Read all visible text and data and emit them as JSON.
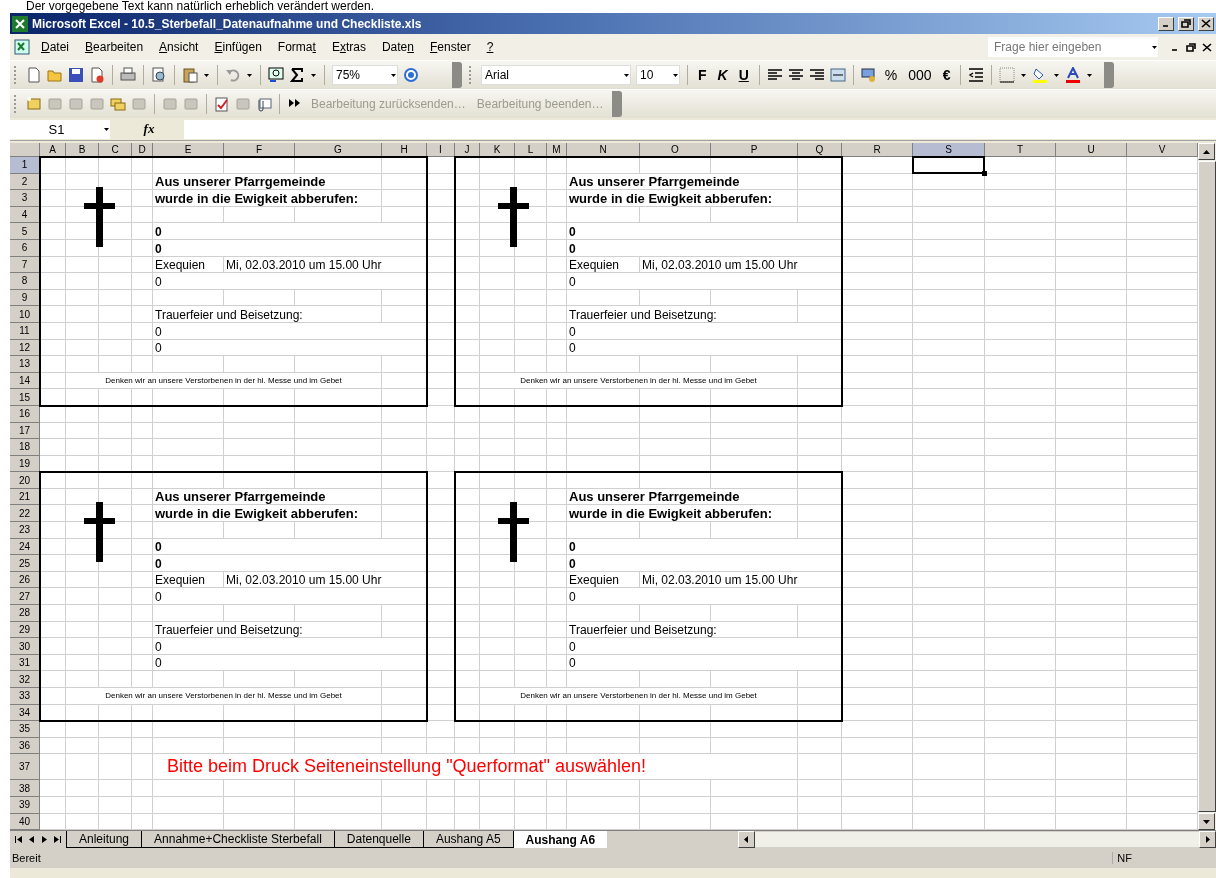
{
  "caption": "Der vorgegebene Text kann natürlich erheblich verändert werden.",
  "window": {
    "title": "Microsoft Excel - 10.5_Sterbefall_Datenaufnahme und Checkliste.xls"
  },
  "menu": [
    {
      "label": "Datei"
    },
    {
      "label": "Bearbeiten"
    },
    {
      "label": "Ansicht"
    },
    {
      "label": "Einfügen"
    },
    {
      "label": "Format"
    },
    {
      "label": "Extras"
    },
    {
      "label": "Daten"
    },
    {
      "label": "Fenster"
    },
    {
      "label": "?"
    }
  ],
  "help_search": {
    "placeholder": "Frage hier eingeben"
  },
  "standard_toolbar": {
    "zoom": "75%"
  },
  "formatting_toolbar": {
    "font": "Arial",
    "size": "10",
    "bold": "F",
    "italic": "K",
    "underline": "U",
    "percent": "%",
    "thousands": "000",
    "euro": "€"
  },
  "review_toolbar": [
    {
      "label": "Bearbeitung zurücksenden…",
      "disabled": true
    },
    {
      "label": "Bearbeitung beenden…",
      "disabled": true
    }
  ],
  "name_box": "S1",
  "formula_label": "fx",
  "columns": [
    {
      "label": "A",
      "selected": false
    },
    {
      "label": "B",
      "selected": false
    },
    {
      "label": "C",
      "selected": false
    },
    {
      "label": "D",
      "selected": false
    },
    {
      "label": "E",
      "selected": false
    },
    {
      "label": "F",
      "selected": false
    },
    {
      "label": "G",
      "selected": false
    },
    {
      "label": "H",
      "selected": false
    },
    {
      "label": "I",
      "selected": false
    },
    {
      "label": "J",
      "selected": false
    },
    {
      "label": "K",
      "selected": false
    },
    {
      "label": "L",
      "selected": false
    },
    {
      "label": "M",
      "selected": false
    },
    {
      "label": "N",
      "selected": false
    },
    {
      "label": "O",
      "selected": false
    },
    {
      "label": "P",
      "selected": false
    },
    {
      "label": "Q",
      "selected": false
    },
    {
      "label": "R",
      "selected": false
    },
    {
      "label": "S",
      "selected": true
    },
    {
      "label": "T",
      "selected": false
    },
    {
      "label": "U",
      "selected": false
    },
    {
      "label": "V",
      "selected": false
    }
  ],
  "rows": [
    {
      "label": "1",
      "selected": true
    },
    {
      "label": "2",
      "selected": false
    },
    {
      "label": "3",
      "selected": false
    },
    {
      "label": "4",
      "selected": false
    },
    {
      "label": "5",
      "selected": false
    },
    {
      "label": "6",
      "selected": false
    },
    {
      "label": "7",
      "selected": false
    },
    {
      "label": "8",
      "selected": false
    },
    {
      "label": "9",
      "selected": false
    },
    {
      "label": "10",
      "selected": false
    },
    {
      "label": "11",
      "selected": false
    },
    {
      "label": "12",
      "selected": false
    },
    {
      "label": "13",
      "selected": false
    },
    {
      "label": "14",
      "selected": false
    },
    {
      "label": "15",
      "selected": false
    },
    {
      "label": "16",
      "selected": false
    },
    {
      "label": "17",
      "selected": false
    },
    {
      "label": "18",
      "selected": false
    },
    {
      "label": "19",
      "selected": false
    },
    {
      "label": "20",
      "selected": false
    },
    {
      "label": "21",
      "selected": false
    },
    {
      "label": "22",
      "selected": false
    },
    {
      "label": "23",
      "selected": false
    },
    {
      "label": "24",
      "selected": false
    },
    {
      "label": "25",
      "selected": false
    },
    {
      "label": "26",
      "selected": false
    },
    {
      "label": "27",
      "selected": false
    },
    {
      "label": "28",
      "selected": false
    },
    {
      "label": "29",
      "selected": false
    },
    {
      "label": "30",
      "selected": false
    },
    {
      "label": "31",
      "selected": false
    },
    {
      "label": "32",
      "selected": false
    },
    {
      "label": "33",
      "selected": false
    },
    {
      "label": "34",
      "selected": false
    },
    {
      "label": "35",
      "selected": false
    },
    {
      "label": "36",
      "selected": false
    },
    {
      "label": "37",
      "selected": false
    },
    {
      "label": "38",
      "selected": false
    },
    {
      "label": "39",
      "selected": false
    },
    {
      "label": "40",
      "selected": false
    }
  ],
  "cards": [
    {
      "heading": [
        "Aus unserer Pfarrgemeinde",
        "wurde in die Ewigkeit abberufen:"
      ],
      "names": [
        "0",
        "0"
      ],
      "service_label": "Exequien",
      "service_date": "Mi, 02.03.2010 um 15.00 Uhr",
      "service_place": "0",
      "burial_label": "Trauerfeier und Beisetzung:",
      "burial_lines": [
        "0",
        "0"
      ],
      "footer": "Denken wir an unsere Verstorbenen in der hl. Messe und im Gebet"
    },
    {
      "heading": [
        "Aus unserer Pfarrgemeinde",
        "wurde in die Ewigkeit abberufen:"
      ],
      "names": [
        "0",
        "0"
      ],
      "service_label": "Exequien",
      "service_date": "Mi, 02.03.2010 um 15.00 Uhr",
      "service_place": "0",
      "burial_label": "Trauerfeier und Beisetzung:",
      "burial_lines": [
        "0",
        "0"
      ],
      "footer": "Denken wir an unsere Verstorbenen in der hl. Messe und im Gebet"
    },
    {
      "heading": [
        "Aus unserer Pfarrgemeinde",
        "wurde in die Ewigkeit abberufen:"
      ],
      "names": [
        "0",
        "0"
      ],
      "service_label": "Exequien",
      "service_date": "Mi, 02.03.2010 um 15.00 Uhr",
      "service_place": "0",
      "burial_label": "Trauerfeier und Beisetzung:",
      "burial_lines": [
        "0",
        "0"
      ],
      "footer": "Denken wir an unsere Verstorbenen in der hl. Messe und im Gebet"
    },
    {
      "heading": [
        "Aus unserer Pfarrgemeinde",
        "wurde in die Ewigkeit abberufen:"
      ],
      "names": [
        "0",
        "0"
      ],
      "service_label": "Exequien",
      "service_date": "Mi, 02.03.2010 um 15.00 Uhr",
      "service_place": "0",
      "burial_label": "Trauerfeier und Beisetzung:",
      "burial_lines": [
        "0",
        "0"
      ],
      "footer": "Denken wir an unsere Verstorbenen in der hl. Messe und im Gebet"
    }
  ],
  "notice": "Bitte beim Druck Seiteneinstellung \"Querformat\" auswählen!",
  "sheet_tabs": [
    {
      "label": "Anleitung",
      "selected": false
    },
    {
      "label": "Annahme+Checkliste Sterbefall",
      "selected": false
    },
    {
      "label": "Datenquelle",
      "selected": false
    },
    {
      "label": "Aushang A5",
      "selected": false
    },
    {
      "label": "Aushang A6",
      "selected": true
    }
  ],
  "status_bar": {
    "state": "Bereit",
    "indicator": "NF"
  }
}
